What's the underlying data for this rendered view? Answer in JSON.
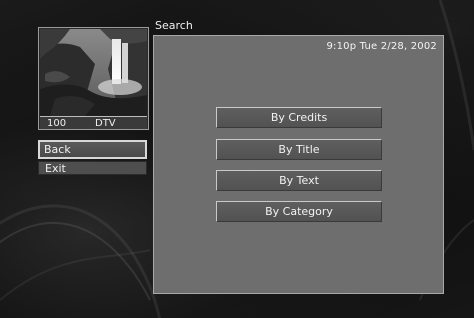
{
  "channel": {
    "number": "100",
    "label": "DTV"
  },
  "menu": {
    "back": "Back",
    "exit": "Exit"
  },
  "panel": {
    "title": "Search",
    "clock": "9:10p Tue 2/28, 2002"
  },
  "options": [
    {
      "label": "By Credits"
    },
    {
      "label": "By Title"
    },
    {
      "label": "By Text"
    },
    {
      "label": "By Category"
    }
  ],
  "colors": {
    "panel_bg": "#6e6e6e",
    "button_bg": "#585858",
    "menu_bg": "#4e4e4e"
  }
}
